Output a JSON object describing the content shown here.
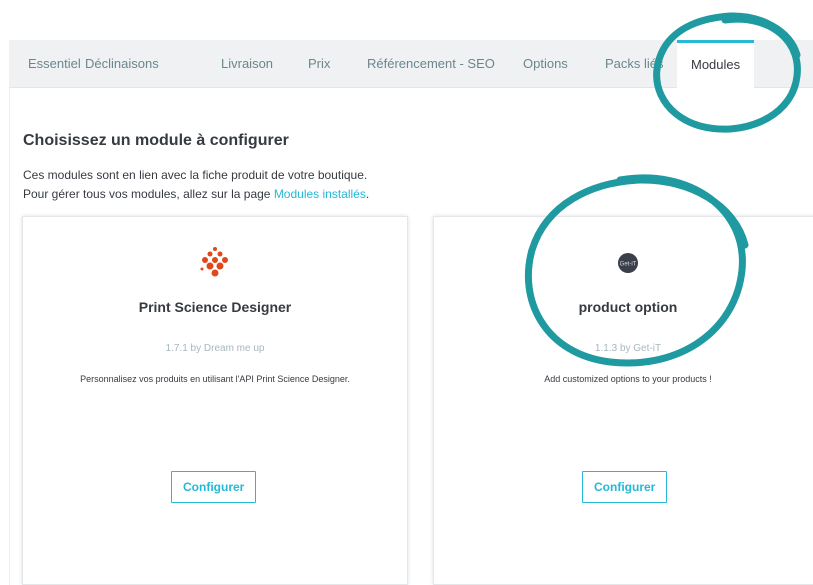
{
  "tabs": [
    {
      "label": "Essentiel"
    },
    {
      "label": "Déclinaisons"
    },
    {
      "label": "Livraison"
    },
    {
      "label": "Prix"
    },
    {
      "label": "Référencement - SEO"
    },
    {
      "label": "Options"
    },
    {
      "label": "Packs liés"
    },
    {
      "label": "Modules",
      "active": true
    }
  ],
  "section": {
    "title": "Choisissez un module à configurer",
    "line1": "Ces modules sont en lien avec la fiche produit de votre boutique.",
    "line2_prefix": "Pour gérer tous vos modules, allez sur la page ",
    "line2_link": "Modules installés",
    "line2_suffix": "."
  },
  "modules": [
    {
      "name": "Print Science Designer",
      "version": "1.7.1 by Dream me up",
      "description": "Personnalisez vos produits en utilisant l'API Print Science Designer.",
      "button": "Configurer",
      "icon": "print-science-dots-icon",
      "icon_color": "#e0471b"
    },
    {
      "name": "product option",
      "version": "1.1.3 by Get-iT",
      "description": "Add customized options to your products !",
      "button": "Configurer",
      "icon": "get-it-logo-icon",
      "icon_text": "Get-iT",
      "icon_color": "#3a3f4a"
    }
  ],
  "colors": {
    "accent": "#25b9d7",
    "annotation": "#1e9aa0"
  }
}
